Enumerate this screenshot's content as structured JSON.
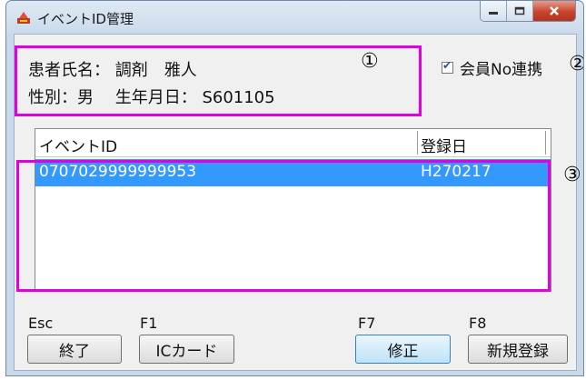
{
  "window": {
    "title": "イベントID管理"
  },
  "info": {
    "line1": "患者氏名： 調剤　雅人",
    "line2": "性別：男　 生年月日： S601105",
    "marker": "①"
  },
  "link_checkbox": {
    "label": "会員No連携",
    "checked": true,
    "marker": "②"
  },
  "table": {
    "headers": [
      "イベントID",
      "登録日"
    ],
    "rows": [
      {
        "event_id": "0707029999999953",
        "reg_date": "H270217",
        "selected": true
      }
    ],
    "marker": "③"
  },
  "buttons": [
    {
      "key": "Esc",
      "label": "終了"
    },
    {
      "key": "F1",
      "label": "ICカード"
    },
    {
      "key": "F7",
      "label": "修正"
    },
    {
      "key": "F8",
      "label": "新規登録"
    }
  ],
  "colors": {
    "highlight": "#e000e0",
    "selection": "#3399ff"
  },
  "icons": {
    "app": "app-logo-icon",
    "minimize": "minimize-icon",
    "maximize": "maximize-icon",
    "close": "close-icon"
  }
}
